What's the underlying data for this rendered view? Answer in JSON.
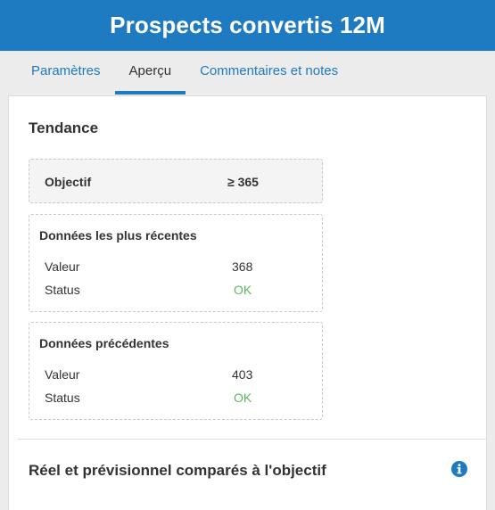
{
  "header": {
    "title": "Prospects convertis 12M"
  },
  "tabs": [
    {
      "label": "Paramètres",
      "active": false
    },
    {
      "label": "Aperçu",
      "active": true
    },
    {
      "label": "Commentaires et notes",
      "active": false
    }
  ],
  "trend": {
    "title": "Tendance",
    "objective": {
      "label": "Objectif",
      "value": "≥ 365"
    },
    "recent": {
      "title": "Données les plus récentes",
      "value_label": "Valeur",
      "value": "368",
      "status_label": "Status",
      "status": "OK"
    },
    "previous": {
      "title": "Données précédentes",
      "value_label": "Valeur",
      "value": "403",
      "status_label": "Status",
      "status": "OK"
    }
  },
  "comparison": {
    "title": "Réel et prévisionnel comparés à l'objectif",
    "icon": "info-icon"
  },
  "colors": {
    "accent": "#1f7bc1",
    "ok": "#5cb85c"
  }
}
